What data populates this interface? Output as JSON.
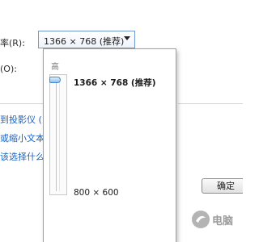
{
  "settings": {
    "resolution_label": "率(R):",
    "orientation_label": "(O):",
    "resolution_value": "1366 × 768 (推荐)"
  },
  "links": [
    {
      "text": "到投影仪 ("
    },
    {
      "text": "或缩小文本"
    },
    {
      "text": "该选择什么"
    }
  ],
  "dropdown": {
    "high_label": "高",
    "options": [
      {
        "label": "1366 × 768 (推荐)",
        "selected": true
      },
      {
        "label": "800 × 600",
        "selected": false
      }
    ],
    "slider_level": 1.0
  },
  "buttons": {
    "ok_label": "确定"
  },
  "watermark": {
    "text": "电脑"
  },
  "colors": {
    "link": "#1a63c5",
    "accent_border": "#6f9ad0"
  }
}
